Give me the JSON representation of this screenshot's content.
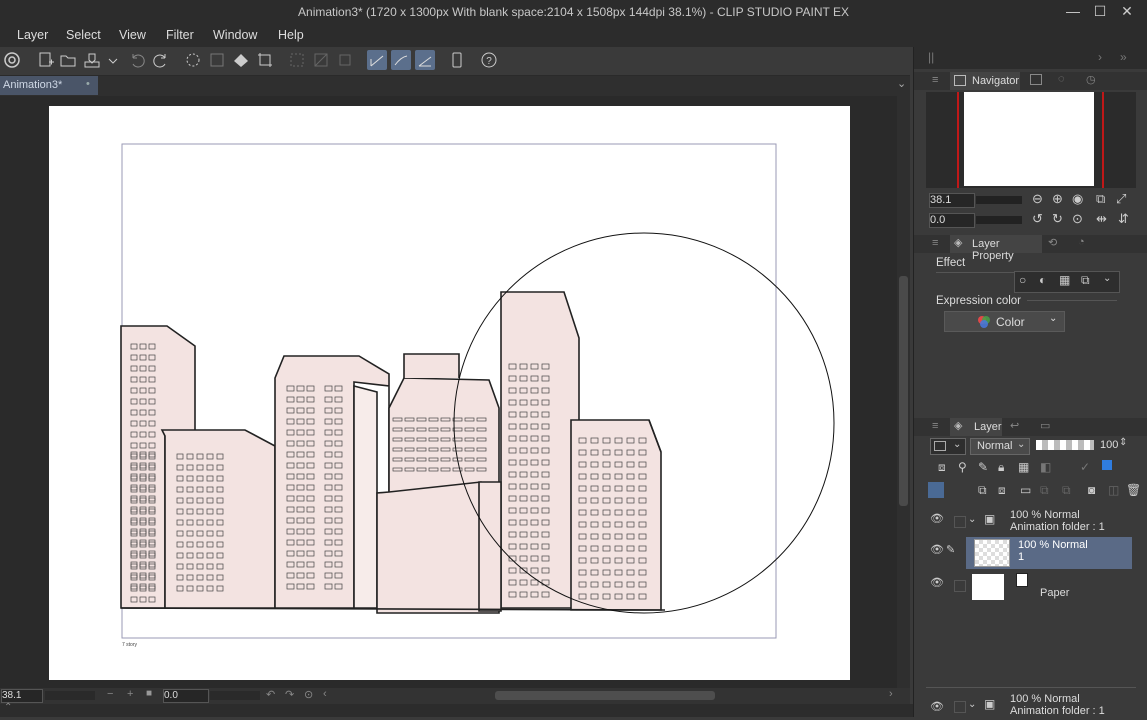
{
  "window": {
    "title": "Animation3* (1720 x 1300px With blank space:2104 x 1508px 144dpi 38.1%)  - CLIP STUDIO PAINT EX",
    "minimize": "—",
    "maximize": "☐",
    "close": "✕"
  },
  "menu": [
    "Layer",
    "Select",
    "View",
    "Filter",
    "Window",
    "Help"
  ],
  "document_tab": {
    "label": "Animation3*",
    "marker": "•"
  },
  "canvas": {
    "frame_caption": "7 story"
  },
  "navigator": {
    "tab_label": "Navigator",
    "zoom_value": "38.1",
    "rotation_value": "0.0"
  },
  "layer_property": {
    "tab_label": "Layer Property",
    "effect_label": "Effect",
    "expression_color_label": "Expression color",
    "expression_color_value": "Color"
  },
  "layer_panel": {
    "tab_label": "Layer",
    "blend_mode": "Normal",
    "opacity": "100",
    "layers": [
      {
        "line1": "100 % Normal",
        "line2": "Animation folder : 1",
        "kind": "folder"
      },
      {
        "line1": "100 % Normal",
        "line2": "1",
        "kind": "raster",
        "selected": true
      },
      {
        "line1": "Paper",
        "line2": "",
        "kind": "paper"
      }
    ],
    "bottom_layer": {
      "line1": "100 % Normal",
      "line2": "Animation folder : 1"
    }
  },
  "statusbar": {
    "zoom_value": "38.1",
    "rotation_value": "0.0"
  },
  "colors": {
    "accent": "#5b6f8c",
    "building_fill": "#f3e3e1",
    "panel_bg": "#3a3a3a",
    "canvas_bg": "#2a2a2a"
  }
}
